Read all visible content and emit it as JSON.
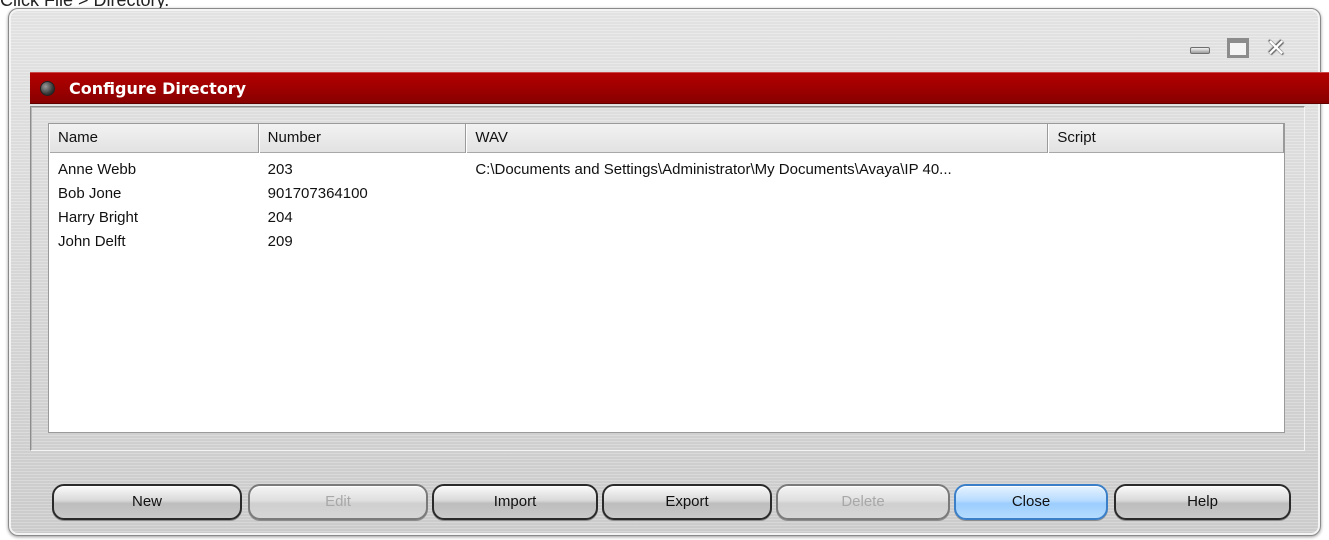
{
  "caption": "Click File > Directory.",
  "window": {
    "title": "Configure Directory",
    "controls": {
      "minimize_icon": "minimize-icon",
      "maximize_icon": "maximize-icon",
      "close_icon": "close-icon",
      "close_glyph": "✕"
    }
  },
  "table": {
    "columns": [
      "Name",
      "Number",
      "WAV",
      "Script"
    ],
    "rows": [
      {
        "name": "Anne Webb",
        "number": "203",
        "wav": "C:\\Documents and Settings\\Administrator\\My Documents\\Avaya\\IP 40...",
        "script": ""
      },
      {
        "name": "Bob Jone",
        "number": "901707364100",
        "wav": "",
        "script": ""
      },
      {
        "name": "Harry Bright",
        "number": "204",
        "wav": "",
        "script": ""
      },
      {
        "name": "John Delft",
        "number": "209",
        "wav": "",
        "script": ""
      }
    ]
  },
  "buttons": {
    "new": "New",
    "edit": "Edit",
    "import": "Import",
    "export": "Export",
    "delete": "Delete",
    "close": "Close",
    "help": "Help"
  },
  "colors": {
    "title_bar": "#9a0000",
    "primary_button": "#9ccdfd"
  }
}
